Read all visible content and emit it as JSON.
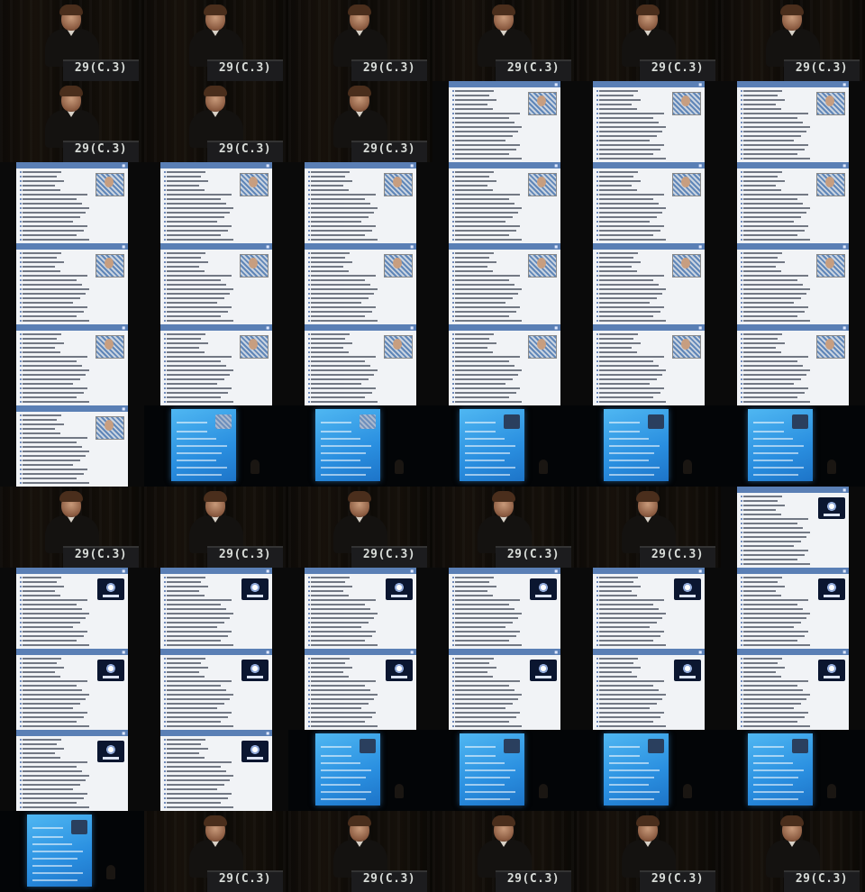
{
  "contact_sheet": {
    "columns": 6,
    "rows": 11,
    "timecode_label": "29(C.3)",
    "colors": {
      "background": "#050505",
      "slide_header": "#5a7fb5",
      "projection": "#2a8fe0"
    },
    "frames": [
      {
        "kind": "speaker"
      },
      {
        "kind": "speaker"
      },
      {
        "kind": "speaker"
      },
      {
        "kind": "speaker"
      },
      {
        "kind": "speaker"
      },
      {
        "kind": "speaker"
      },
      {
        "kind": "speaker"
      },
      {
        "kind": "speaker"
      },
      {
        "kind": "speaker"
      },
      {
        "kind": "slide",
        "graphic": "photo"
      },
      {
        "kind": "slide",
        "graphic": "photo"
      },
      {
        "kind": "slide",
        "graphic": "photo"
      },
      {
        "kind": "slide",
        "graphic": "photo"
      },
      {
        "kind": "slide",
        "graphic": "photo"
      },
      {
        "kind": "slide",
        "graphic": "photo"
      },
      {
        "kind": "slide",
        "graphic": "photo"
      },
      {
        "kind": "slide",
        "graphic": "photo"
      },
      {
        "kind": "slide",
        "graphic": "photo"
      },
      {
        "kind": "slide",
        "graphic": "photo"
      },
      {
        "kind": "slide",
        "graphic": "photo"
      },
      {
        "kind": "slide",
        "graphic": "photo"
      },
      {
        "kind": "slide",
        "graphic": "photo"
      },
      {
        "kind": "slide",
        "graphic": "photo"
      },
      {
        "kind": "slide",
        "graphic": "photo"
      },
      {
        "kind": "slide",
        "graphic": "photo"
      },
      {
        "kind": "slide",
        "graphic": "photo"
      },
      {
        "kind": "slide",
        "graphic": "photo"
      },
      {
        "kind": "slide",
        "graphic": "photo"
      },
      {
        "kind": "slide",
        "graphic": "photo"
      },
      {
        "kind": "slide",
        "graphic": "photo"
      },
      {
        "kind": "slide",
        "graphic": "photo"
      },
      {
        "kind": "projected",
        "graphic": "photo"
      },
      {
        "kind": "projected",
        "graphic": "photo"
      },
      {
        "kind": "projected",
        "graphic": "logo"
      },
      {
        "kind": "projected",
        "graphic": "logo"
      },
      {
        "kind": "projected",
        "graphic": "logo"
      },
      {
        "kind": "speaker"
      },
      {
        "kind": "speaker"
      },
      {
        "kind": "speaker"
      },
      {
        "kind": "speaker"
      },
      {
        "kind": "speaker"
      },
      {
        "kind": "slide",
        "graphic": "logo"
      },
      {
        "kind": "slide",
        "graphic": "logo"
      },
      {
        "kind": "slide",
        "graphic": "logo"
      },
      {
        "kind": "slide",
        "graphic": "logo"
      },
      {
        "kind": "slide",
        "graphic": "logo"
      },
      {
        "kind": "slide",
        "graphic": "logo"
      },
      {
        "kind": "slide",
        "graphic": "logo"
      },
      {
        "kind": "slide",
        "graphic": "logo"
      },
      {
        "kind": "slide",
        "graphic": "logo"
      },
      {
        "kind": "slide",
        "graphic": "logo"
      },
      {
        "kind": "slide",
        "graphic": "logo"
      },
      {
        "kind": "slide",
        "graphic": "logo"
      },
      {
        "kind": "slide",
        "graphic": "logo"
      },
      {
        "kind": "slide",
        "graphic": "logo"
      },
      {
        "kind": "slide",
        "graphic": "logo"
      },
      {
        "kind": "projected",
        "graphic": "logo"
      },
      {
        "kind": "projected",
        "graphic": "logo"
      },
      {
        "kind": "projected",
        "graphic": "logo"
      },
      {
        "kind": "projected",
        "graphic": "logo"
      },
      {
        "kind": "projected",
        "graphic": "logo"
      },
      {
        "kind": "speaker"
      },
      {
        "kind": "speaker"
      },
      {
        "kind": "speaker"
      },
      {
        "kind": "speaker"
      },
      {
        "kind": "speaker"
      }
    ]
  }
}
